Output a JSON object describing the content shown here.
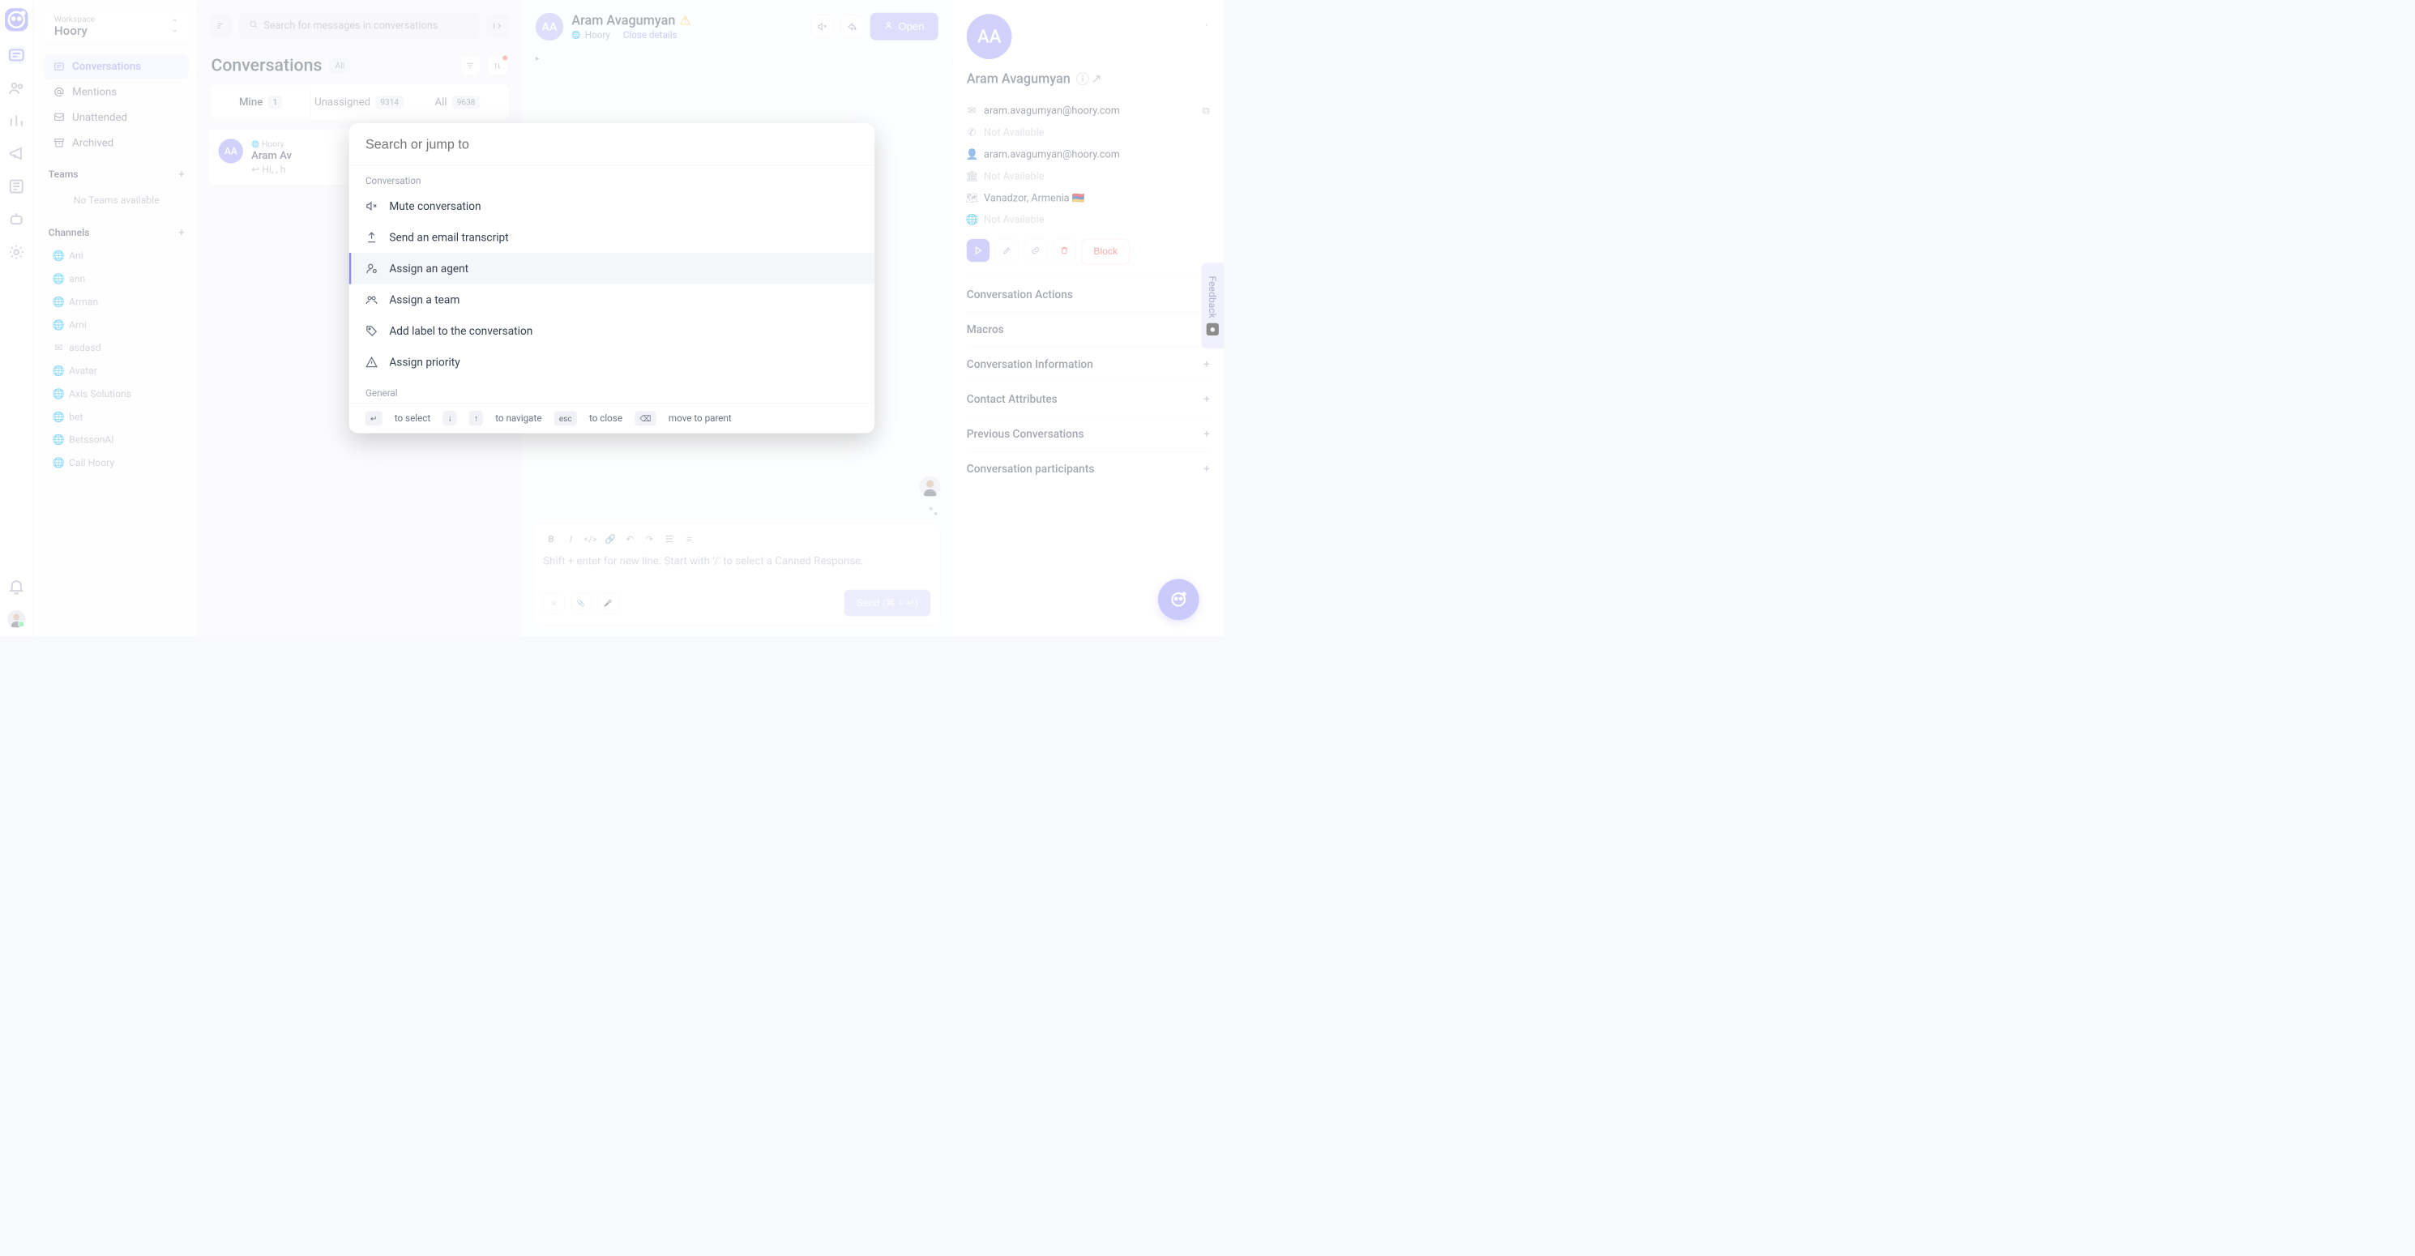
{
  "workspace": {
    "label": "Workspace",
    "name": "Hoory"
  },
  "nav": {
    "items": [
      {
        "label": "Conversations",
        "active": true
      },
      {
        "label": "Mentions"
      },
      {
        "label": "Unattended"
      },
      {
        "label": "Archived"
      }
    ]
  },
  "teams": {
    "heading": "Teams",
    "empty": "No Teams available"
  },
  "channels": {
    "heading": "Channels",
    "items": [
      "Ani",
      "ann",
      "Arman",
      "Arni",
      "asdasd",
      "Avatar",
      "Axis Solutions",
      "bet",
      "BetssonAI",
      "Call Hoory"
    ]
  },
  "search": {
    "placeholder": "Search for messages in conversations"
  },
  "conversations": {
    "title": "Conversations",
    "filter": "All",
    "tabs": [
      {
        "label": "Mine",
        "count": "1",
        "active": true
      },
      {
        "label": "Unassigned",
        "count": "9314"
      },
      {
        "label": "All",
        "count": "9638"
      }
    ],
    "item": {
      "source": "Hoory",
      "name": "Aram Av",
      "initials": "AA",
      "preview": "Hi, , h"
    }
  },
  "chat": {
    "name": "Aram Avagumyan",
    "initials": "AA",
    "source": "Hoory",
    "close_details": "Close details",
    "open_label": "Open",
    "composer_placeholder": "Shift + enter for new line. Start with '/' to select a Canned Response.",
    "send_label": "Send (⌘ + ↵)"
  },
  "details": {
    "initials": "AA",
    "name": "Aram Avagumyan",
    "email": "aram.avagumyan@hoory.com",
    "phone": "Not Available",
    "alt_email": "aram.avagumyan@hoory.com",
    "company": "Not Available",
    "location": "Vanadzor, Armenia 🇦🇲",
    "browser": "Not Available",
    "block": "Block",
    "sections": [
      "Conversation Actions",
      "Macros",
      "Conversation Information",
      "Contact Attributes",
      "Previous Conversations",
      "Conversation participants"
    ]
  },
  "palette": {
    "placeholder": "Search or jump to",
    "groups": [
      {
        "label": "Conversation",
        "items": [
          {
            "label": "Mute conversation",
            "icon": "mute"
          },
          {
            "label": "Send an email transcript",
            "icon": "upload"
          },
          {
            "label": "Assign an agent",
            "icon": "agent",
            "hl": true
          },
          {
            "label": "Assign a team",
            "icon": "team"
          },
          {
            "label": "Add label to the conversation",
            "icon": "tag"
          },
          {
            "label": "Assign priority",
            "icon": "warn"
          }
        ]
      },
      {
        "label": "General",
        "items": []
      }
    ],
    "hints": {
      "select": "to select",
      "navigate": "to navigate",
      "esc": "esc",
      "close": "to close",
      "parent": "move to parent"
    }
  },
  "feedback": {
    "label": "Feedback"
  }
}
